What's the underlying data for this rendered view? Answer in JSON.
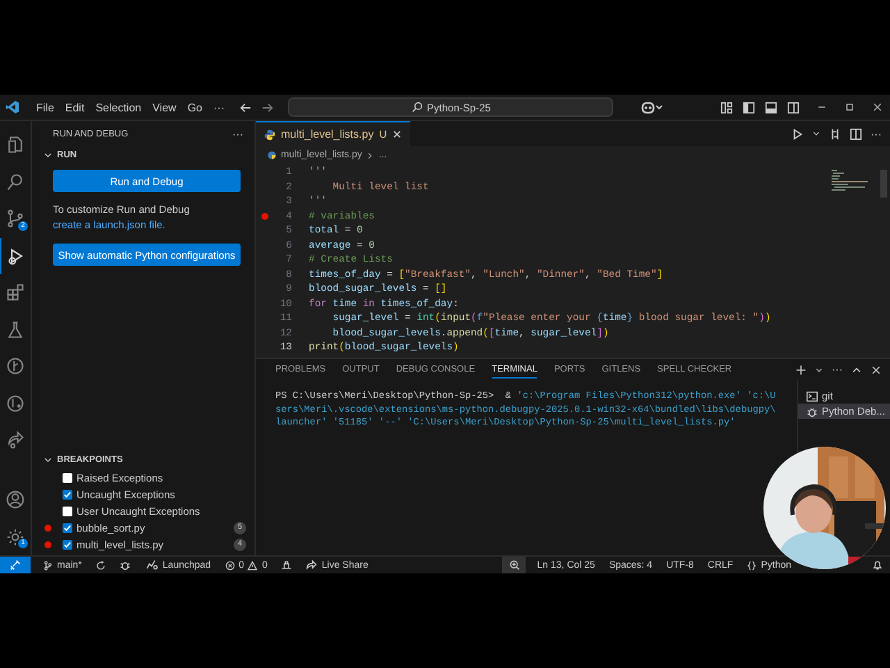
{
  "title_bar": {
    "menu": [
      "File",
      "Edit",
      "Selection",
      "View",
      "Go",
      "···"
    ],
    "search": "Python-Sp-25"
  },
  "activity_bar": {
    "top": [
      {
        "kind": "explorer",
        "selected": false
      },
      {
        "kind": "search",
        "selected": false
      },
      {
        "kind": "scm",
        "selected": false,
        "badge": "2"
      },
      {
        "kind": "debug",
        "selected": true
      },
      {
        "kind": "extensions",
        "selected": false
      },
      {
        "kind": "testing",
        "selected": false
      },
      {
        "kind": "graph",
        "selected": false
      },
      {
        "kind": "inspect",
        "selected": false
      },
      {
        "kind": "share",
        "selected": false
      }
    ],
    "bottom": [
      {
        "kind": "account",
        "selected": false
      },
      {
        "kind": "settings",
        "selected": false,
        "badge": "1"
      }
    ]
  },
  "sidebar": {
    "title": "RUN AND DEBUG",
    "more": "···",
    "run_section": "RUN",
    "run_button": "Run and Debug",
    "hint": "To customize Run and Debug",
    "hint_link": "create a launch.json file.",
    "config_button": "Show automatic Python configurations",
    "breakpoints_title": "BREAKPOINTS",
    "breakpoints": [
      {
        "kind": "exception",
        "label": "Raised Exceptions",
        "checked": false
      },
      {
        "kind": "exception",
        "label": "Uncaught Exceptions",
        "checked": true
      },
      {
        "kind": "exception",
        "label": "User Uncaught Exceptions",
        "checked": false
      },
      {
        "kind": "file",
        "label": "bubble_sort.py",
        "checked": true,
        "count": "5"
      },
      {
        "kind": "file",
        "label": "multi_level_lists.py",
        "checked": true,
        "count": "4"
      }
    ]
  },
  "editor": {
    "tab": {
      "label": "multi_level_lists.py",
      "badge": "U",
      "selected": true
    },
    "breadcrumb": [
      "multi_level_lists.py",
      "..."
    ],
    "lines": [
      {
        "number": "1",
        "breakpoint": false,
        "current": false,
        "tokens": [
          {
            "kind": "str",
            "text": "'''"
          }
        ]
      },
      {
        "number": "2",
        "breakpoint": false,
        "current": false,
        "tokens": [
          {
            "kind": "str",
            "text": "    Multi level list"
          }
        ]
      },
      {
        "number": "3",
        "breakpoint": false,
        "current": false,
        "tokens": [
          {
            "kind": "str",
            "text": "'''"
          }
        ]
      },
      {
        "number": "4",
        "breakpoint": true,
        "current": false,
        "tokens": [
          {
            "kind": "cmt",
            "text": "# variables"
          }
        ]
      },
      {
        "number": "5",
        "breakpoint": false,
        "current": false,
        "tokens": [
          {
            "kind": "var",
            "text": "total"
          },
          {
            "kind": "op",
            "text": " = "
          },
          {
            "kind": "num",
            "text": "0"
          }
        ]
      },
      {
        "number": "6",
        "breakpoint": false,
        "current": false,
        "tokens": [
          {
            "kind": "var",
            "text": "average"
          },
          {
            "kind": "op",
            "text": " = "
          },
          {
            "kind": "num",
            "text": "0"
          }
        ]
      },
      {
        "number": "7",
        "breakpoint": false,
        "current": false,
        "tokens": [
          {
            "kind": "cmt",
            "text": "# Create Lists"
          }
        ]
      },
      {
        "number": "8",
        "breakpoint": false,
        "current": false,
        "tokens": [
          {
            "kind": "var",
            "text": "times_of_day"
          },
          {
            "kind": "op",
            "text": " = "
          },
          {
            "kind": "br",
            "text": "["
          },
          {
            "kind": "str",
            "text": "\"Breakfast\""
          },
          {
            "kind": "op",
            "text": ", "
          },
          {
            "kind": "str",
            "text": "\"Lunch\""
          },
          {
            "kind": "op",
            "text": ", "
          },
          {
            "kind": "str",
            "text": "\"Dinner\""
          },
          {
            "kind": "op",
            "text": ", "
          },
          {
            "kind": "str",
            "text": "\"Bed Time\""
          },
          {
            "kind": "br",
            "text": "]"
          }
        ]
      },
      {
        "number": "9",
        "breakpoint": false,
        "current": false,
        "tokens": [
          {
            "kind": "var",
            "text": "blood_sugar_levels"
          },
          {
            "kind": "op",
            "text": " = "
          },
          {
            "kind": "br",
            "text": "[]"
          }
        ]
      },
      {
        "number": "10",
        "breakpoint": false,
        "current": false,
        "tokens": [
          {
            "kind": "kw",
            "text": "for"
          },
          {
            "kind": "var",
            "text": " time "
          },
          {
            "kind": "kw",
            "text": "in"
          },
          {
            "kind": "var",
            "text": " times_of_day"
          },
          {
            "kind": "op",
            "text": ":"
          }
        ]
      },
      {
        "number": "11",
        "breakpoint": false,
        "current": false,
        "tokens": [
          {
            "kind": "var",
            "text": "    sugar_level"
          },
          {
            "kind": "op",
            "text": " = "
          },
          {
            "kind": "type",
            "text": "int"
          },
          {
            "kind": "br",
            "text": "("
          },
          {
            "kind": "fn",
            "text": "input"
          },
          {
            "kind": "br2",
            "text": "("
          },
          {
            "kind": "kw2",
            "text": "f"
          },
          {
            "kind": "str",
            "text": "\"Please enter your "
          },
          {
            "kind": "kw2",
            "text": "{"
          },
          {
            "kind": "var",
            "text": "time"
          },
          {
            "kind": "kw2",
            "text": "}"
          },
          {
            "kind": "str",
            "text": " blood sugar level: \""
          },
          {
            "kind": "br2",
            "text": ")"
          },
          {
            "kind": "br",
            "text": ")"
          }
        ]
      },
      {
        "number": "12",
        "breakpoint": false,
        "current": false,
        "tokens": [
          {
            "kind": "var",
            "text": "    blood_sugar_levels"
          },
          {
            "kind": "op",
            "text": "."
          },
          {
            "kind": "fn",
            "text": "append"
          },
          {
            "kind": "br",
            "text": "("
          },
          {
            "kind": "br2",
            "text": "["
          },
          {
            "kind": "var",
            "text": "time"
          },
          {
            "kind": "op",
            "text": ", "
          },
          {
            "kind": "var",
            "text": "sugar_level"
          },
          {
            "kind": "br2",
            "text": "]"
          },
          {
            "kind": "br",
            "text": ")"
          }
        ]
      },
      {
        "number": "13",
        "breakpoint": false,
        "current": true,
        "tokens": [
          {
            "kind": "fn",
            "text": "print"
          },
          {
            "kind": "br",
            "text": "("
          },
          {
            "kind": "var",
            "text": "blood_sugar_levels"
          },
          {
            "kind": "br",
            "text": ")"
          }
        ]
      }
    ]
  },
  "panel": {
    "tabs": [
      {
        "label": "PROBLEMS",
        "selected": false
      },
      {
        "label": "OUTPUT",
        "selected": false
      },
      {
        "label": "DEBUG CONSOLE",
        "selected": false
      },
      {
        "label": "TERMINAL",
        "selected": true
      },
      {
        "label": "PORTS",
        "selected": false
      },
      {
        "label": "GITLENS",
        "selected": false
      },
      {
        "label": "SPELL CHECKER",
        "selected": false
      }
    ],
    "terminal": [
      [
        {
          "kind": "plain",
          "text": "PS C:\\Users\\Meri\\Desktop\\Python-Sp-25>  & "
        },
        {
          "kind": "str",
          "text": "'c:\\Program Files\\Python312\\python.exe' 'c:\\U"
        }
      ],
      [
        {
          "kind": "str",
          "text": "sers\\Meri\\.vscode\\extensions\\ms-python.debugpy-2025.0.1-win32-x64\\bundled\\libs\\debugpy\\"
        }
      ],
      [
        {
          "kind": "str",
          "text": "launcher' '51185' '--' 'C:\\Users\\Meri\\Desktop\\Python-Sp-25\\multi_level_lists.py'"
        }
      ]
    ],
    "terminals": [
      {
        "kind": "shell",
        "label": "git",
        "selected": false
      },
      {
        "kind": "debug",
        "label": "Python Deb...",
        "selected": true
      }
    ]
  },
  "status_bar": {
    "branch": "main*",
    "launchpad": "Launchpad",
    "errors": "0",
    "warnings": "0",
    "live_share": "Live Share",
    "position": "Ln 13, Col 25",
    "spaces": "Spaces: 4",
    "encoding": "UTF-8",
    "eol": "CRLF",
    "language": "Python"
  }
}
